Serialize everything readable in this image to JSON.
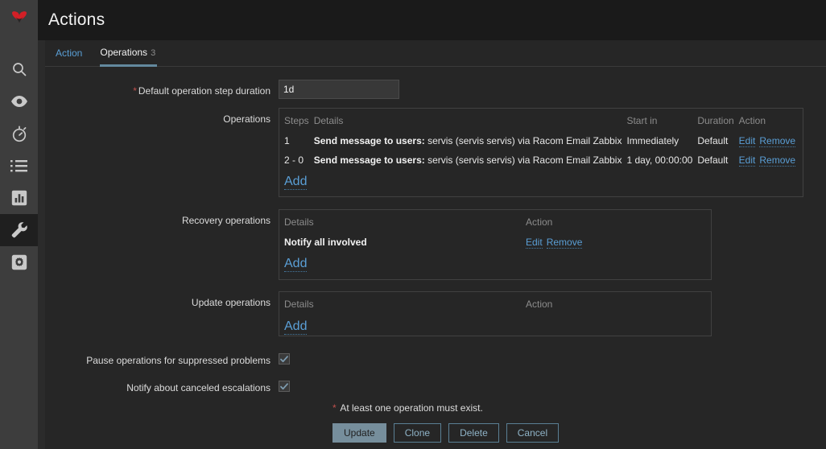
{
  "header": {
    "title": "Actions"
  },
  "sidebar": {
    "logo": "zabbix-logo",
    "items": [
      {
        "icon": "search-icon",
        "name": "search"
      },
      {
        "icon": "eye-icon",
        "name": "monitoring"
      },
      {
        "icon": "stopwatch-icon",
        "name": "services"
      },
      {
        "icon": "list-icon",
        "name": "inventory"
      },
      {
        "icon": "bar-chart-icon",
        "name": "reports"
      },
      {
        "icon": "wrench-icon",
        "name": "configuration",
        "active": true
      },
      {
        "icon": "gear-box-icon",
        "name": "administration"
      }
    ]
  },
  "tabs": [
    {
      "label": "Action",
      "active": false,
      "count": ""
    },
    {
      "label": "Operations",
      "active": true,
      "count": "3"
    }
  ],
  "form": {
    "step_duration": {
      "label": "Default operation step duration",
      "required": true,
      "value": "1d"
    },
    "operations": {
      "label": "Operations",
      "headers": [
        "Steps",
        "Details",
        "Start in",
        "Duration",
        "Action"
      ],
      "rows": [
        {
          "steps": "1",
          "details_bold": "Send message to users:",
          "details_rest": " servis (servis servis) via Racom Email Zabbix",
          "start_in": "Immediately",
          "duration": "Default",
          "edit": "Edit",
          "remove": "Remove"
        },
        {
          "steps": "2 - 0",
          "details_bold": "Send message to users:",
          "details_rest": " servis (servis servis) via Racom Email Zabbix",
          "start_in": "1 day, 00:00:00",
          "duration": "Default",
          "edit": "Edit",
          "remove": "Remove"
        }
      ],
      "add": "Add"
    },
    "recovery_operations": {
      "label": "Recovery operations",
      "headers": [
        "Details",
        "Action"
      ],
      "rows": [
        {
          "details": "Notify all involved",
          "edit": "Edit",
          "remove": "Remove"
        }
      ],
      "add": "Add"
    },
    "update_operations": {
      "label": "Update operations",
      "headers": [
        "Details",
        "Action"
      ],
      "rows": [],
      "add": "Add"
    },
    "pause_suppressed": {
      "label": "Pause operations for suppressed problems",
      "checked": true
    },
    "notify_canceled": {
      "label": "Notify about canceled escalations",
      "checked": true
    }
  },
  "footer": {
    "note_marker": "*",
    "note": "At least one operation must exist.",
    "buttons": [
      {
        "label": "Update",
        "primary": true
      },
      {
        "label": "Clone",
        "primary": false
      },
      {
        "label": "Delete",
        "primary": false
      },
      {
        "label": "Cancel",
        "primary": false
      }
    ]
  },
  "colors": {
    "link": "#5a9fd6",
    "accent_underline": "#63899e",
    "required": "#c0504d",
    "logo": "#d31f26",
    "panel_bg": "#262626",
    "sidebar_bg": "#3d3d3d",
    "header_bg": "#1a1a1a"
  }
}
